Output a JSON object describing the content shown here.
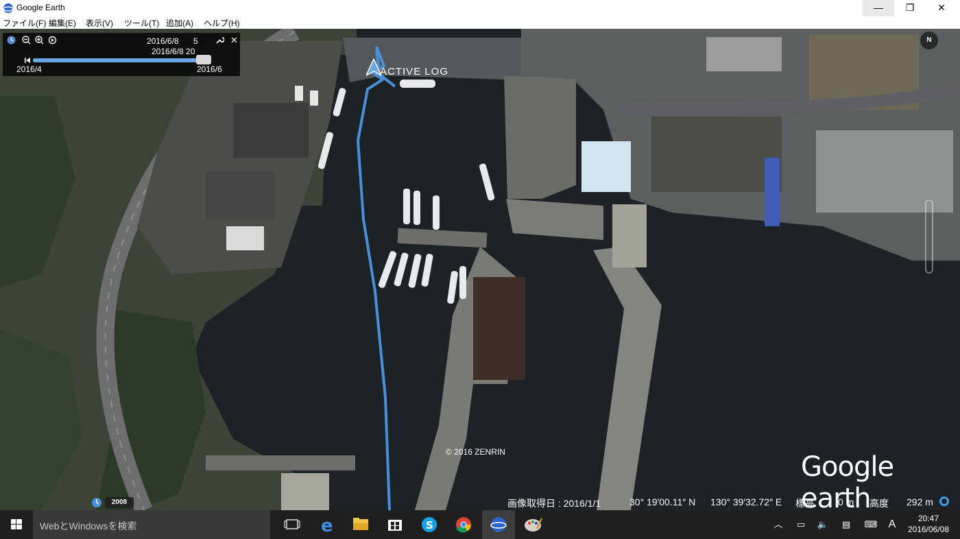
{
  "window": {
    "title": "Google Earth",
    "min_glyph": "—",
    "max_glyph": "❐",
    "close_glyph": "✕"
  },
  "menu": [
    "ファイル(F)",
    "編集(E)",
    "表示(V)",
    "ツール(T)",
    "追加(A)",
    "ヘルプ(H)"
  ],
  "time_slider": {
    "range_start_label": "2016/6/8",
    "range_start_extra": "5",
    "range_end_label": "2016/6/8 20",
    "axis_start": "2016/4",
    "axis_end": "2016/6",
    "position_fraction": 0.97
  },
  "map": {
    "placemark_label": "ACTIVE LOG",
    "copyright": "© 2016 ZENRIN",
    "logo": "Google earth",
    "historical_imagery_year": "2008",
    "compass_label": "N"
  },
  "status_bar": {
    "imagery_date": "画像取得日 : 2016/1/1",
    "latitude": "30° 19′00.11″ N",
    "longitude": "130° 39′32.72″ E",
    "elevation_label": "標高",
    "elevation_value": "0 m",
    "altitude_label": "高度",
    "altitude_value": "292 m"
  },
  "taskbar": {
    "search_placeholder": "WebとWindowsを検索",
    "apps": [
      "task-view",
      "edge",
      "file-explorer",
      "store",
      "skype",
      "chrome",
      "google-earth",
      "paint"
    ],
    "ime_label": "A",
    "time": "20:47",
    "date": "2016/06/08"
  },
  "colors": {
    "track": "#4a90d9",
    "water": "#1c2226",
    "taskbar": "#1f1f1f"
  }
}
